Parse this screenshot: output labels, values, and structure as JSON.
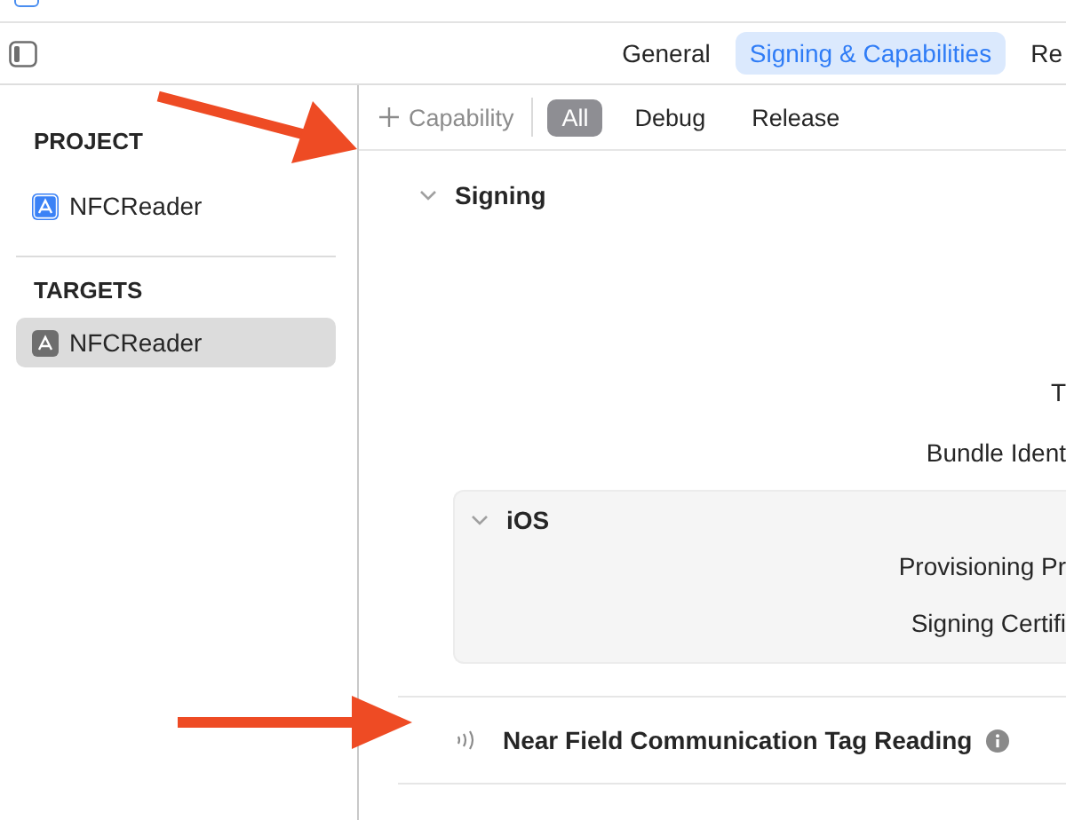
{
  "toolbar": {
    "tabs": [
      {
        "label": "General",
        "selected": false
      },
      {
        "label": "Signing & Capabilities",
        "selected": true
      },
      {
        "label": "Re",
        "selected": false
      }
    ]
  },
  "sidebar": {
    "sections": [
      {
        "title": "PROJECT",
        "items": [
          {
            "label": "NFCReader",
            "kind": "project",
            "selected": false
          }
        ]
      },
      {
        "title": "TARGETS",
        "items": [
          {
            "label": "NFCReader",
            "kind": "target",
            "selected": true
          }
        ]
      }
    ]
  },
  "editor_bar": {
    "add_button": "Capability",
    "filters": [
      {
        "label": "All",
        "selected": true
      },
      {
        "label": "Debug",
        "selected": false
      },
      {
        "label": "Release",
        "selected": false
      }
    ]
  },
  "signing": {
    "title": "Signing",
    "expanded": true,
    "fields": [
      "T",
      "Bundle Ident"
    ],
    "platform": {
      "title": "iOS",
      "expanded": true,
      "fields": [
        "Provisioning Pr",
        "Signing Certifi"
      ]
    }
  },
  "capabilities": [
    {
      "title": "Near Field Communication Tag Reading"
    }
  ]
}
